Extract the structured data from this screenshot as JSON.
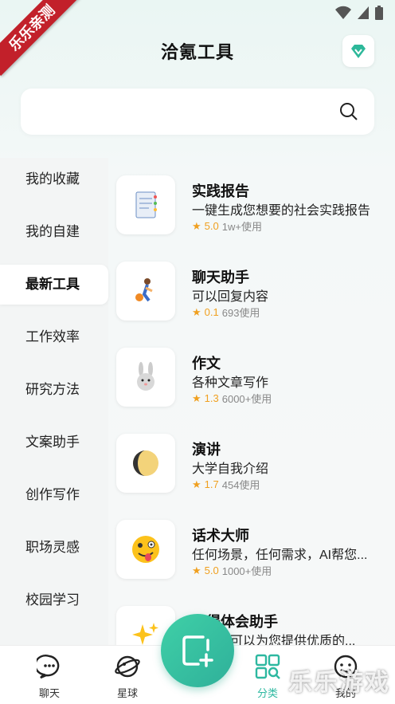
{
  "ribbon": "乐乐亲测",
  "header": {
    "title": "洽氪工具"
  },
  "search": {
    "placeholder": ""
  },
  "sidebar": {
    "items": [
      {
        "label": "我的收藏"
      },
      {
        "label": "我的自建"
      },
      {
        "label": "最新工具",
        "active": true
      },
      {
        "label": "工作效率"
      },
      {
        "label": "研究方法"
      },
      {
        "label": "文案助手"
      },
      {
        "label": "创作写作"
      },
      {
        "label": "职场灵感"
      },
      {
        "label": "校园学习"
      }
    ]
  },
  "tools": [
    {
      "name": "实践报告",
      "desc": "一键生成您想要的社会实践报告",
      "rating": "5.0",
      "usage": "1w+使用",
      "icon": "document-icon"
    },
    {
      "name": "聊天助手",
      "desc": "可以回复内容",
      "rating": "0.1",
      "usage": "693使用",
      "icon": "basketball-player-icon"
    },
    {
      "name": "作文",
      "desc": "各种文章写作",
      "rating": "1.3",
      "usage": "6000+使用",
      "icon": "rabbit-icon"
    },
    {
      "name": "演讲",
      "desc": "大学自我介绍",
      "rating": "1.7",
      "usage": "454使用",
      "icon": "moon-icon"
    },
    {
      "name": "话术大师",
      "desc": "任何场景，任何需求，AI帮您...",
      "rating": "5.0",
      "usage": "1000+使用",
      "icon": "tongue-face-icon"
    },
    {
      "name": "心得体会助手",
      "desc": "该工具可以为您提供优质的...",
      "rating": "",
      "usage": "",
      "icon": "sparkles-icon"
    }
  ],
  "tabbar": {
    "tabs": [
      {
        "label": "聊天",
        "icon": "chat-icon"
      },
      {
        "label": "星球",
        "icon": "planet-icon"
      },
      {
        "label": "分类",
        "icon": "category-icon",
        "active": true
      },
      {
        "label": "我的",
        "icon": "profile-icon"
      }
    ]
  },
  "watermark": "乐乐游戏",
  "colors": {
    "accent": "#2db8a0",
    "ribbon": "#c2202a",
    "star": "#f0a020"
  }
}
